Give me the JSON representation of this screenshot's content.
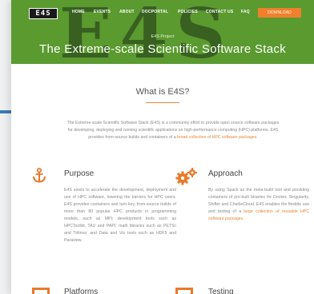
{
  "nav": {
    "logo": "E4S",
    "items": [
      "HOME",
      "EVENTS",
      "ABOUT",
      "DOCPORTAL",
      "POLICIES",
      "CONTACT US",
      "FAQ"
    ],
    "cta": "DOWNLOAD"
  },
  "hero": {
    "watermark": "E4S",
    "subtitle": "E4S Project",
    "title": "The Extreme-scale Scientific Software Stack"
  },
  "about": {
    "title": "What is E4S?",
    "intro_text": "The Extreme-scale Scientific Software Stack (E4S) is a community effort to provide open source software packages for developing, deploying and running scientific applications on high-performance computing (HPC) platforms. E4S provides from-source builds and containers of a",
    "intro_link": "broad collection of HPC software packages."
  },
  "cards": {
    "purpose": {
      "title": "Purpose",
      "text": "E4S exists to accelerate the development, deployment and use of HPC software, lowering the barriers for HPC users. E4S provides containers and turn-key, from-source builds of more than 80 popular HPC products in programming models, such as MPI; development tools such as HPCToolkit, TAU and PAPI; math libraries such as PETSc and Trilinos; and Data and Viz tools such as HDF5 and Paraview."
    },
    "approach": {
      "title": "Approach",
      "text": "By using Spack as the meta-build tool and providing containers of pre-built binaries for Docker, Singularity, Shifter and CharlieCloud, E4S enables the flexible use and testing of a",
      "link": "large collection of reusable HPC software packages."
    },
    "platforms": {
      "title": "Platforms"
    },
    "testing": {
      "title": "Testing"
    }
  },
  "colors": {
    "hero_green": "#5a9a2f",
    "accent_orange": "#e8792a",
    "left_accent_blue": "#3d7bb0"
  },
  "icons": {
    "purpose": "anchor-icon",
    "approach": "gears-icon"
  }
}
